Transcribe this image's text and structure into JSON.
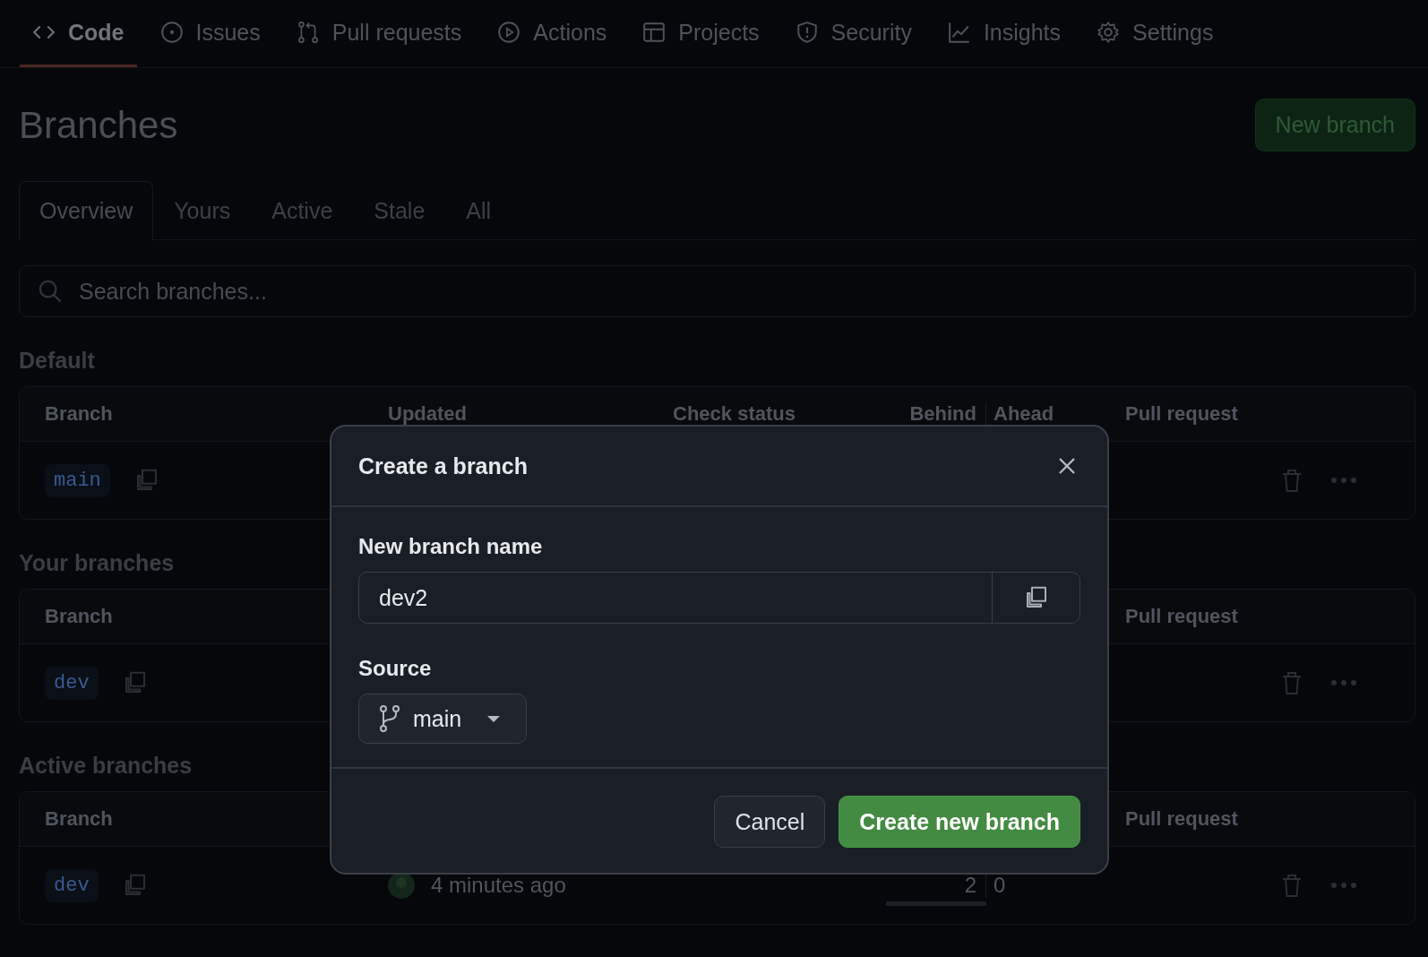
{
  "nav": [
    {
      "label": "Code",
      "selected": true
    },
    {
      "label": "Issues",
      "selected": false
    },
    {
      "label": "Pull requests",
      "selected": false
    },
    {
      "label": "Actions",
      "selected": false
    },
    {
      "label": "Projects",
      "selected": false
    },
    {
      "label": "Security",
      "selected": false
    },
    {
      "label": "Insights",
      "selected": false
    },
    {
      "label": "Settings",
      "selected": false
    }
  ],
  "page_title": "Branches",
  "new_branch_button": "New branch",
  "tabs": [
    {
      "label": "Overview",
      "selected": true
    },
    {
      "label": "Yours",
      "selected": false
    },
    {
      "label": "Active",
      "selected": false
    },
    {
      "label": "Stale",
      "selected": false
    },
    {
      "label": "All",
      "selected": false
    }
  ],
  "search": {
    "placeholder": "Search branches..."
  },
  "sections": [
    {
      "title": "Default",
      "columns": [
        {
          "kind": "branch",
          "label": "Branch"
        },
        {
          "kind": "updated",
          "label": "Updated"
        },
        {
          "kind": "status",
          "label": "Check status"
        },
        {
          "kind": "behind",
          "label": "Behind"
        },
        {
          "kind": "ahead",
          "label": "Ahead"
        },
        {
          "kind": "pr",
          "label": "Pull request"
        }
      ],
      "rows": [
        {
          "branch": "main"
        }
      ]
    },
    {
      "title": "Your branches",
      "columns": [
        {
          "kind": "branch",
          "label": "Branch"
        },
        {
          "kind": "pr",
          "label": "Pull request"
        }
      ],
      "rows": [
        {
          "branch": "dev"
        }
      ]
    },
    {
      "title": "Active branches",
      "columns": [
        {
          "kind": "branch",
          "label": "Branch"
        },
        {
          "kind": "pr",
          "label": "Pull request"
        }
      ],
      "rows": [
        {
          "branch": "dev",
          "updated": "4 minutes ago",
          "behind": "2",
          "ahead": "0",
          "behind_bar": {
            "level": 1
          }
        }
      ]
    }
  ],
  "dialog": {
    "title": "Create a branch",
    "name_label": "New branch name",
    "name_value": "dev2",
    "source_label": "Source",
    "source_value": "main",
    "buttons": [
      {
        "label": "Cancel",
        "kind": "secondary"
      },
      {
        "label": "Create new branch",
        "kind": "primary"
      }
    ]
  }
}
